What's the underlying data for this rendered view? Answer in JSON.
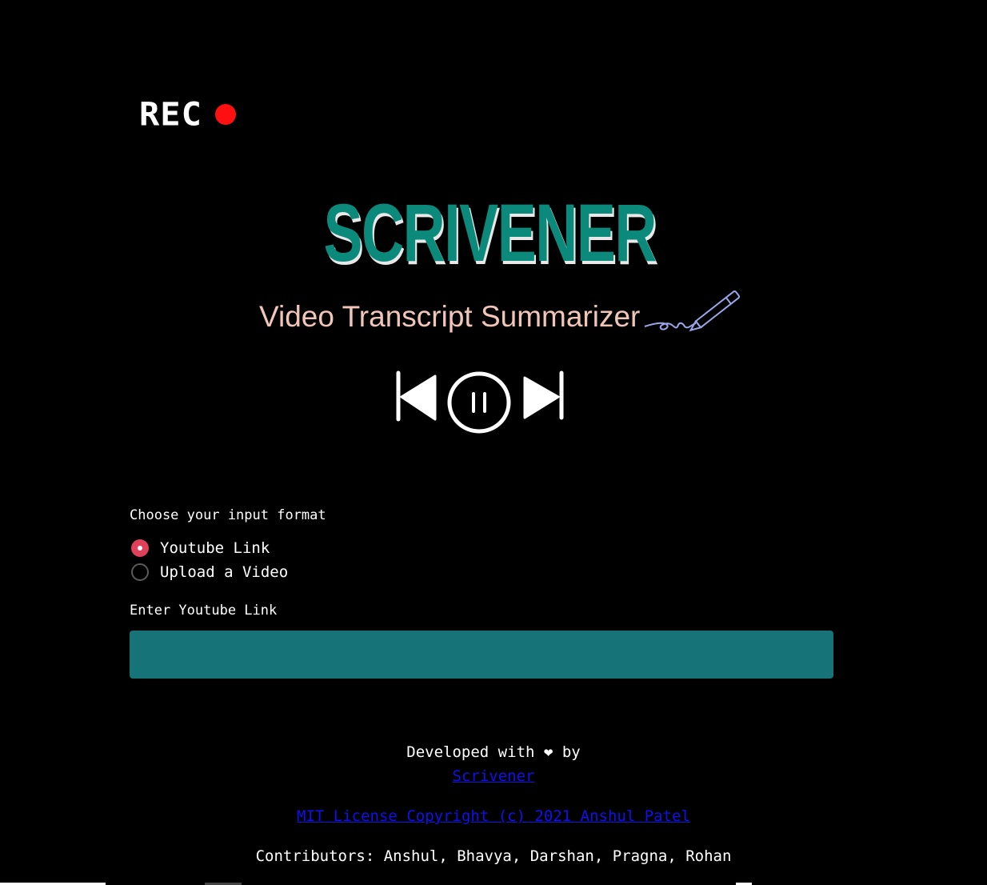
{
  "header": {
    "rec_label": "REC"
  },
  "brand": {
    "title": "SCRIVENER",
    "tagline": "Video Transcript Summarizer"
  },
  "form": {
    "choose_label": "Choose your input format",
    "options": [
      {
        "label": "Youtube Link",
        "selected": true
      },
      {
        "label": "Upload a Video",
        "selected": false
      }
    ],
    "enter_label": "Enter Youtube Link",
    "link_value": ""
  },
  "footer": {
    "developed_prefix": "Developed with",
    "heart": "❤",
    "developed_suffix": "by",
    "author_link": "Scrivener",
    "license_link": "MIT License Copyright (c) 2021 Anshul Patel",
    "contributors": "Contributors: Anshul, Bhavya, Darshan, Pragna, Rohan"
  },
  "colors": {
    "background": "#000000",
    "brand": "#0b8a7c",
    "tagline": "#f1c6b8",
    "radio_selected": "#e0405a",
    "input_bg": "#167377",
    "link": "#1010ee",
    "rec_dot": "#ff1010"
  },
  "icons": [
    "rec-dot-icon",
    "pen-icon",
    "skip-back-icon",
    "pause-icon",
    "skip-forward-icon",
    "heart-icon"
  ]
}
